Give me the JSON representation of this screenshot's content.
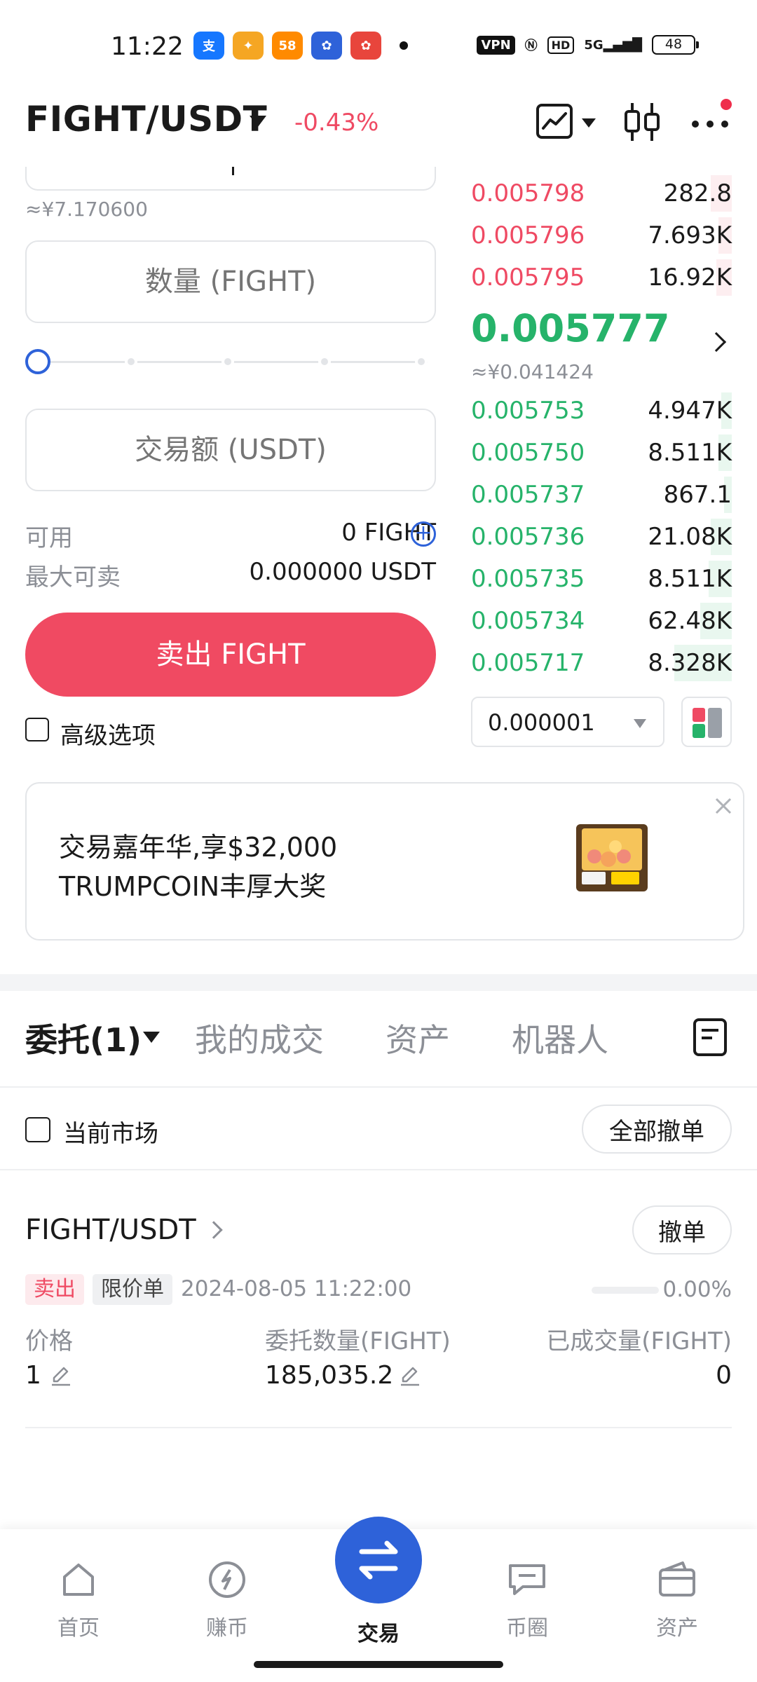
{
  "status_bar": {
    "time": "11:22",
    "apps": [
      "alipay-app-icon",
      "game-app-icon",
      "58-app-icon",
      "baidu-app-icon",
      "baidu-lite-app-icon"
    ],
    "app_58_label": "58",
    "vpn": "VPN",
    "hd": "HD",
    "network": "5G",
    "battery": "48"
  },
  "header": {
    "pair": "FIGHT/USDT",
    "change": "-0.43%"
  },
  "order_form": {
    "price_cny": "≈¥7.170600",
    "quantity_placeholder": "数量 (FIGHT)",
    "amount_placeholder": "交易额 (USDT)",
    "slider_fraction": 0,
    "available_label": "可用",
    "available_value": "0 FIGHT",
    "max_sell_label": "最大可卖",
    "max_sell_value": "0.000000 USDT",
    "sell_button": "卖出 FIGHT",
    "advanced_label": "高级选项"
  },
  "order_book": {
    "asks": [
      {
        "price": "0.005798",
        "qty": "282.8",
        "depth": 0.08
      },
      {
        "price": "0.005796",
        "qty": "7.693K",
        "depth": 0.05
      },
      {
        "price": "0.005795",
        "qty": "16.92K",
        "depth": 0.06
      }
    ],
    "last_price": "0.005777",
    "last_price_cny": "≈¥0.041424",
    "bids": [
      {
        "price": "0.005753",
        "qty": "4.947K",
        "depth": 0.04
      },
      {
        "price": "0.005750",
        "qty": "8.511K",
        "depth": 0.05
      },
      {
        "price": "0.005737",
        "qty": "867.1",
        "depth": 0.03
      },
      {
        "price": "0.005736",
        "qty": "21.08K",
        "depth": 0.08
      },
      {
        "price": "0.005735",
        "qty": "8.511K",
        "depth": 0.09
      },
      {
        "price": "0.005734",
        "qty": "62.48K",
        "depth": 0.12
      },
      {
        "price": "0.005717",
        "qty": "8.328K",
        "depth": 0.22
      }
    ],
    "precision": "0.000001"
  },
  "banner": {
    "line1": "交易嘉年华,享$32,000",
    "line2": "TRUMPCOIN丰厚大奖"
  },
  "tabs": [
    {
      "label": "委托(1)"
    },
    {
      "label": "我的成交"
    },
    {
      "label": "资产"
    },
    {
      "label": "机器人"
    }
  ],
  "filters": {
    "current_market": "当前市场",
    "cancel_all": "全部撤单"
  },
  "order": {
    "pair": "FIGHT/USDT",
    "cancel": "撤单",
    "side": "卖出",
    "type": "限价单",
    "time": "2024-08-05 11:22:00",
    "filled_pct": "0.00%",
    "filled_fraction": 0,
    "price_label": "价格",
    "price_value": "1",
    "qty_label": "委托数量(FIGHT)",
    "qty_value": "185,035.2",
    "filled_label": "已成交量(FIGHT)",
    "filled_value": "0"
  },
  "bottom_nav": [
    {
      "label": "首页",
      "icon": "home-icon"
    },
    {
      "label": "赚币",
      "icon": "earn-icon"
    },
    {
      "label": "交易",
      "icon": "trade-icon"
    },
    {
      "label": "币圈",
      "icon": "community-icon"
    },
    {
      "label": "资产",
      "icon": "wallet-icon"
    }
  ],
  "colors": {
    "up": "#26b36a",
    "down": "#ef4a63",
    "accent": "#2e62d9"
  }
}
